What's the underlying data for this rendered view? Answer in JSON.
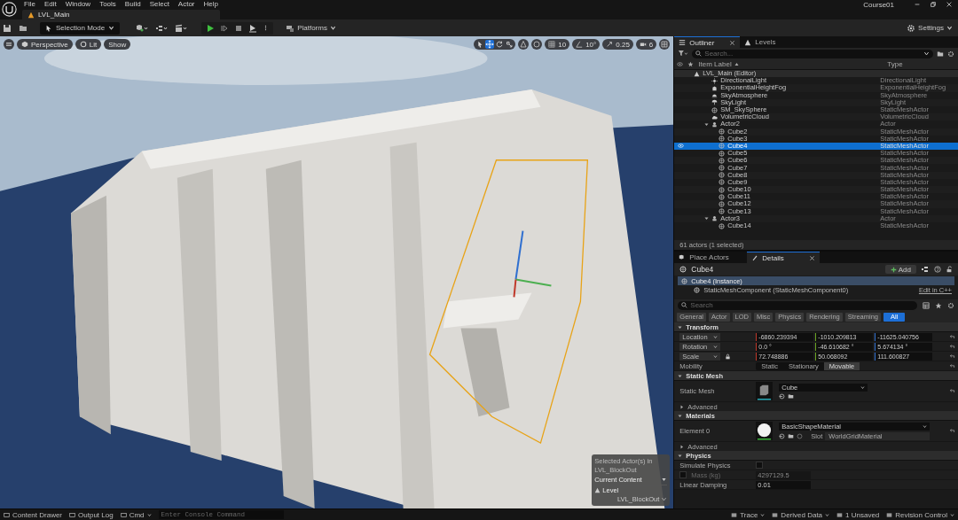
{
  "menu": [
    "File",
    "Edit",
    "Window",
    "Tools",
    "Build",
    "Select",
    "Actor",
    "Help"
  ],
  "document_tab": {
    "label": "LVL_Main"
  },
  "project_name": "Course01",
  "toolbar": {
    "selection_mode": "Selection Mode",
    "platforms": "Platforms",
    "settings": "Settings"
  },
  "viewport": {
    "kind": "picture",
    "view_buttons": [
      {
        "kind": "perspective",
        "label": "Perspective"
      },
      {
        "kind": "lit",
        "label": "Lit"
      },
      {
        "kind": "show",
        "label": "Show"
      }
    ],
    "tools": [
      {
        "kind": "select",
        "selected": false
      },
      {
        "kind": "move",
        "selected": true
      },
      {
        "kind": "rotate",
        "selected": false
      },
      {
        "kind": "scale",
        "selected": false
      }
    ],
    "snap": [
      {
        "kind": "grid",
        "value": "10"
      },
      {
        "kind": "angle",
        "value": "10°"
      },
      {
        "kind": "scale",
        "value": "0.25"
      },
      {
        "kind": "camera",
        "value": "6"
      }
    ],
    "level_popup": {
      "caption": "Selected Actor(s) in",
      "caption_level": "LVL_BlockOut",
      "context": "Current Content",
      "level_label": "Level",
      "level_value": "LVL_BlockOut"
    }
  },
  "outliner": {
    "tabs": [
      {
        "label": "Outliner",
        "selected": true
      },
      {
        "label": "Levels",
        "selected": false
      }
    ],
    "search": {
      "placeholder": "Search..."
    },
    "columns": [
      "Item Label",
      "Type"
    ],
    "root": {
      "label": "LVL_Main (Editor)"
    },
    "rows": [
      {
        "label": "DirectionalLight",
        "type": "DirectionalLight",
        "kind": "light",
        "selected": false
      },
      {
        "label": "ExponentialHeightFog",
        "type": "ExponentialHeightFog",
        "kind": "fog",
        "selected": false
      },
      {
        "label": "SkyAtmosphere",
        "type": "SkyAtmosphere",
        "kind": "atmosphere",
        "selected": false
      },
      {
        "label": "SkyLight",
        "type": "SkyLight",
        "kind": "skylight",
        "selected": false
      },
      {
        "label": "SM_SkySphere",
        "type": "StaticMeshActor",
        "kind": "mesh",
        "selected": false
      },
      {
        "label": "VolumetricCloud",
        "type": "VolumetricCloud",
        "kind": "cloud",
        "selected": false
      },
      {
        "label": "Actor2",
        "type": "Actor",
        "kind": "actor",
        "selected": false,
        "expanded": true,
        "children": [
          {
            "label": "Cube2",
            "type": "StaticMeshActor",
            "kind": "mesh",
            "selected": false
          },
          {
            "label": "Cube3",
            "type": "StaticMeshActor",
            "kind": "mesh",
            "selected": false
          },
          {
            "label": "Cube4",
            "type": "StaticMeshActor",
            "kind": "mesh",
            "selected": true
          },
          {
            "label": "Cube5",
            "type": "StaticMeshActor",
            "kind": "mesh",
            "selected": false
          },
          {
            "label": "Cube6",
            "type": "StaticMeshActor",
            "kind": "mesh",
            "selected": false
          },
          {
            "label": "Cube7",
            "type": "StaticMeshActor",
            "kind": "mesh",
            "selected": false
          },
          {
            "label": "Cube8",
            "type": "StaticMeshActor",
            "kind": "mesh",
            "selected": false
          },
          {
            "label": "Cube9",
            "type": "StaticMeshActor",
            "kind": "mesh",
            "selected": false
          },
          {
            "label": "Cube10",
            "type": "StaticMeshActor",
            "kind": "mesh",
            "selected": false
          },
          {
            "label": "Cube11",
            "type": "StaticMeshActor",
            "kind": "mesh",
            "selected": false
          },
          {
            "label": "Cube12",
            "type": "StaticMeshActor",
            "kind": "mesh",
            "selected": false
          },
          {
            "label": "Cube13",
            "type": "StaticMeshActor",
            "kind": "mesh",
            "selected": false
          }
        ]
      },
      {
        "label": "Actor3",
        "type": "Actor",
        "kind": "actor",
        "selected": false,
        "expanded": true,
        "children": [
          {
            "label": "Cube14",
            "type": "StaticMeshActor",
            "kind": "mesh",
            "selected": false
          }
        ]
      }
    ],
    "footer": "61 actors (1 selected)"
  },
  "details": {
    "tabs": [
      {
        "label": "Place Actors",
        "selected": false
      },
      {
        "label": "Details",
        "selected": true
      }
    ],
    "actor_name": "Cube4",
    "add_button": "Add",
    "components": [
      {
        "label": "Cube4 (Instance)",
        "selected": true
      },
      {
        "label": "StaticMeshComponent (StaticMeshComponent0)",
        "selected": false
      }
    ],
    "edit_link": "Edit in C++",
    "search": {
      "placeholder": "Search"
    },
    "filters": [
      {
        "label": "General",
        "selected": false
      },
      {
        "label": "Actor",
        "selected": false
      },
      {
        "label": "LOD",
        "selected": false
      },
      {
        "label": "Misc",
        "selected": false
      },
      {
        "label": "Physics",
        "selected": false
      },
      {
        "label": "Rendering",
        "selected": false
      },
      {
        "label": "Streaming",
        "selected": false
      },
      {
        "label": "All",
        "selected": true
      }
    ],
    "transform": {
      "title": "Transform",
      "expanded": true,
      "rows": [
        {
          "label": "Location",
          "values": [
            "-6860.239394",
            "-1010.209813",
            "-11625.040756"
          ],
          "locked": false
        },
        {
          "label": "Rotation",
          "values": [
            "0.0 °",
            "-46.610682 °",
            "5.674134 °"
          ],
          "locked": false
        },
        {
          "label": "Scale",
          "values": [
            "72.748886",
            "50.068092",
            "111.600827"
          ],
          "locked": true
        }
      ],
      "mobility": {
        "label": "Mobility",
        "options": [
          {
            "label": "Static",
            "selected": false
          },
          {
            "label": "Stationary",
            "selected": false
          },
          {
            "label": "Movable",
            "selected": true
          }
        ]
      }
    },
    "static_mesh": {
      "title": "Static Mesh",
      "expanded": true,
      "label": "Static Mesh",
      "asset": "Cube",
      "advanced": {
        "label": "Advanced",
        "expanded": false
      }
    },
    "materials": {
      "title": "Materials",
      "expanded": true,
      "label": "Element 0",
      "asset": "BasicShapeMaterial",
      "slot_label": "Slot",
      "slot_value": "WorldGridMaterial",
      "advanced": {
        "label": "Advanced",
        "expanded": false
      }
    },
    "physics": {
      "title": "Physics",
      "expanded": true,
      "simulate": {
        "label": "Simulate Physics",
        "checked": false
      },
      "mass": {
        "label": "Mass (kg)",
        "value": "4297129.5",
        "checked": false
      },
      "damping": {
        "label": "Linear Damping",
        "value": "0.01"
      }
    }
  },
  "status_bar": {
    "left": [
      "Content Drawer",
      "Output Log",
      "Cmd"
    ],
    "console": {
      "placeholder": "Enter Console Command"
    },
    "right": [
      "Trace",
      "Derived Data",
      "1 Unsaved",
      "Revision Control"
    ]
  }
}
